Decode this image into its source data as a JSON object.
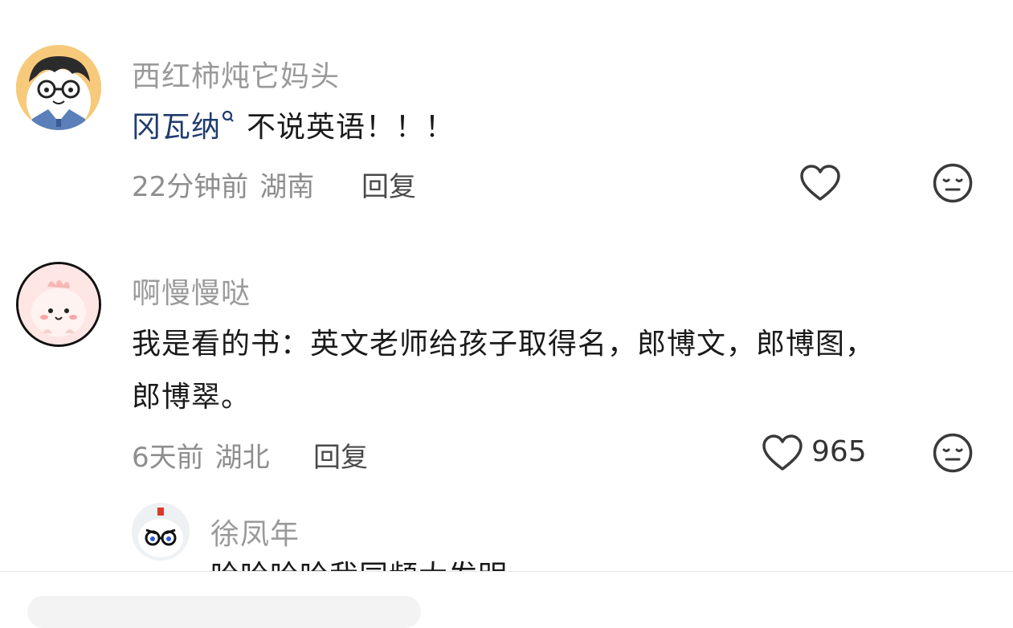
{
  "comments": [
    {
      "username": "西红柿炖它妈头",
      "mention": "冈瓦纳",
      "text": "不说英语！！！",
      "time": "22分钟前",
      "location": "湖南",
      "reply_label": "回复",
      "like_count": ""
    },
    {
      "username": "啊慢慢哒",
      "text_line1": "我是看的书：英文老师给孩子取得名，郎博文，郎博图，",
      "text_line2": "郎博翠。",
      "time": "6天前",
      "location": "湖北",
      "reply_label": "回复",
      "like_count": "965"
    },
    {
      "username": "徐凤年",
      "text_partial": "哈哈哈哈我同频大发明"
    }
  ],
  "icons": {
    "like": "heart-icon",
    "dislike": "neutral-face-icon",
    "search": "search-icon"
  },
  "colors": {
    "mention": "#1f3b6e",
    "meta": "#8e8e8e",
    "username": "#9a9a9a"
  }
}
